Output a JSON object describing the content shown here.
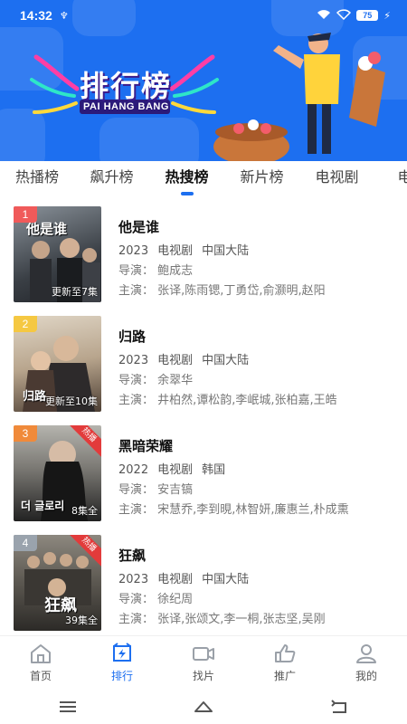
{
  "status_bar": {
    "time": "14:32",
    "battery": "75"
  },
  "banner": {
    "title": "排行榜",
    "subtitle": "PAI HANG BANG"
  },
  "tabs": [
    {
      "label": "热播榜",
      "active": false
    },
    {
      "label": "飙升榜",
      "active": false
    },
    {
      "label": "热搜榜",
      "active": true
    },
    {
      "label": "新片榜",
      "active": false
    },
    {
      "label": "电视剧",
      "active": false
    },
    {
      "label": "电影",
      "active": false
    }
  ],
  "items": [
    {
      "rank": "1",
      "rank_color": "#f05a5a",
      "poster_title": "他是谁",
      "episodes": "更新至7集",
      "hot": "",
      "title": "他是谁",
      "year": "2023",
      "type": "电视剧",
      "region": "中国大陆",
      "director": "导演： 鲍成志",
      "cast": "主演： 张译,陈雨锶,丁勇岱,俞灏明,赵阳",
      "poster_colors": [
        "#3a3f45",
        "#7d8590"
      ]
    },
    {
      "rank": "2",
      "rank_color": "#f5c842",
      "poster_title": "归路",
      "episodes": "更新至10集",
      "hot": "",
      "title": "归路",
      "year": "2023",
      "type": "电视剧",
      "region": "中国大陆",
      "director": "导演： 余翠华",
      "cast": "主演： 井柏然,谭松韵,李岷城,张柏嘉,王皓",
      "poster_colors": [
        "#c9b9a3",
        "#5a4a3e"
      ]
    },
    {
      "rank": "3",
      "rank_color": "#f08a3a",
      "poster_title": "더 글로리",
      "episodes": "8集全",
      "hot": "热播",
      "title": "黑暗荣耀",
      "year": "2022",
      "type": "电视剧",
      "region": "韩国",
      "director": "导演： 安吉镐",
      "cast": "主演： 宋慧乔,李到晛,林智妍,廉惠兰,朴成熏",
      "poster_colors": [
        "#8a8a86",
        "#2a2a2a"
      ]
    },
    {
      "rank": "4",
      "rank_color": "#9aa3ad",
      "poster_title": "狂飙",
      "episodes": "39集全",
      "hot": "热播",
      "title": "狂飙",
      "year": "2023",
      "type": "电视剧",
      "region": "中国大陆",
      "director": "导演： 徐纪周",
      "cast": "主演： 张译,张颂文,李一桐,张志坚,吴刚",
      "poster_colors": [
        "#6d6a63",
        "#3b3834"
      ]
    }
  ],
  "bottom_nav": [
    {
      "label": "首页",
      "icon": "home-icon",
      "active": false
    },
    {
      "label": "排行",
      "icon": "ranking-icon",
      "active": true
    },
    {
      "label": "找片",
      "icon": "video-icon",
      "active": false
    },
    {
      "label": "推广",
      "icon": "thumbs-up-icon",
      "active": false
    },
    {
      "label": "我的",
      "icon": "profile-icon",
      "active": false
    }
  ],
  "colors": {
    "accent": "#1d6ff0",
    "banner_bg": "#1d6ff0"
  }
}
